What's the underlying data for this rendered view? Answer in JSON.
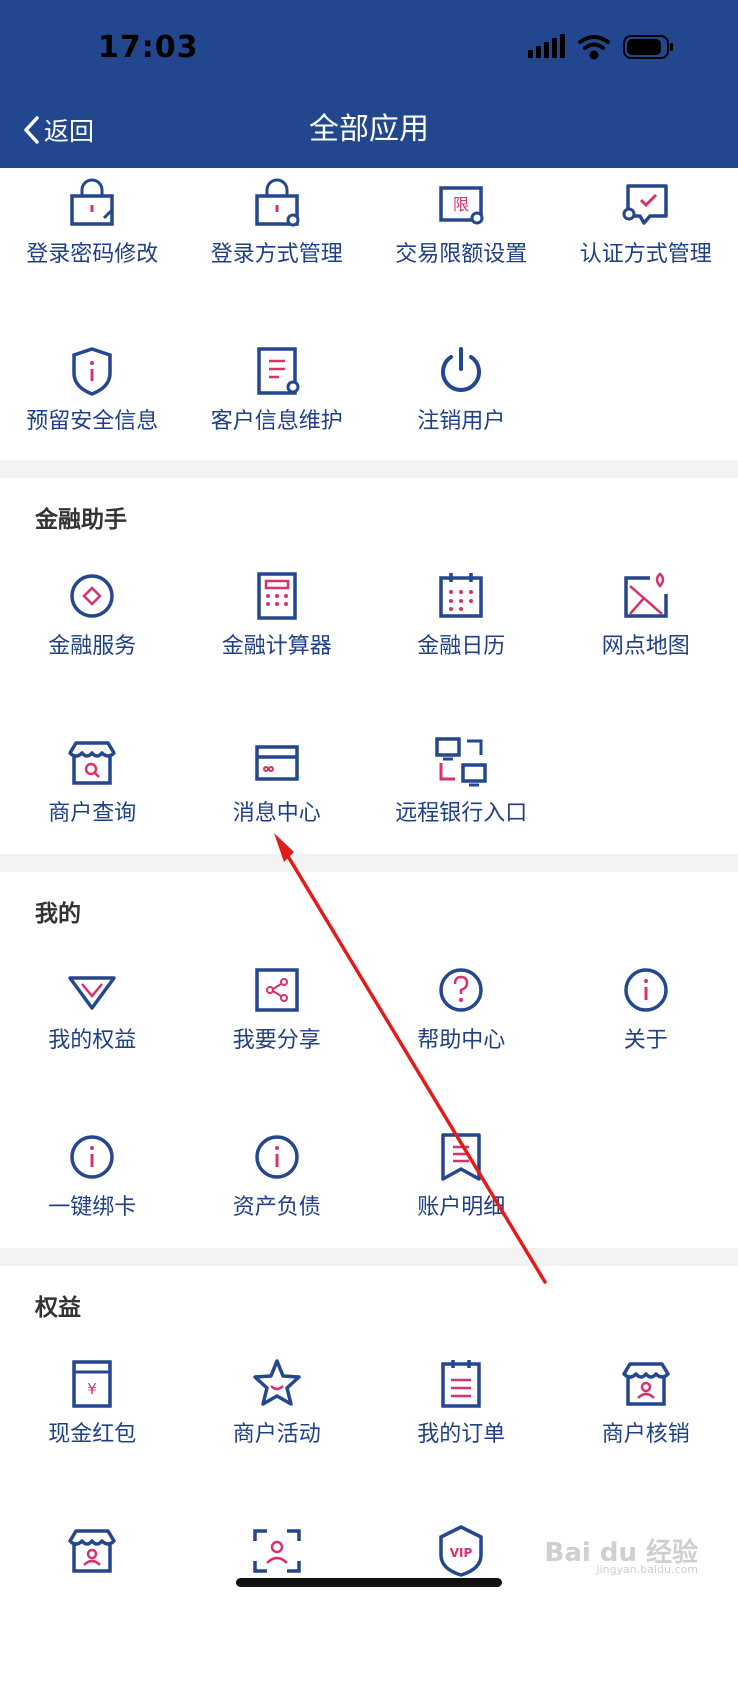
{
  "status_bar": {
    "time": "17:03"
  },
  "header": {
    "back_label": "返回",
    "title": "全部应用"
  },
  "section_security": {
    "items": [
      {
        "label": "登录密码修改",
        "icon": "lock-edit-icon"
      },
      {
        "label": "登录方式管理",
        "icon": "lock-gear-icon"
      },
      {
        "label": "交易限额设置",
        "icon": "limit-gear-icon"
      },
      {
        "label": "认证方式管理",
        "icon": "chat-check-icon"
      },
      {
        "label": "预留安全信息",
        "icon": "shield-info-icon"
      },
      {
        "label": "客户信息维护",
        "icon": "doc-gear-icon"
      },
      {
        "label": "注销用户",
        "icon": "power-icon"
      }
    ]
  },
  "section_finance": {
    "title": "金融助手",
    "items": [
      {
        "label": "金融服务",
        "icon": "diamond-circle-icon"
      },
      {
        "label": "金融计算器",
        "icon": "calculator-icon"
      },
      {
        "label": "金融日历",
        "icon": "calendar-icon"
      },
      {
        "label": "网点地图",
        "icon": "map-pin-icon"
      },
      {
        "label": "商户查询",
        "icon": "store-search-icon"
      },
      {
        "label": "消息中心",
        "icon": "card-icon"
      },
      {
        "label": "远程银行入口",
        "icon": "remote-monitors-icon"
      }
    ]
  },
  "section_mine": {
    "title": "我的",
    "items": [
      {
        "label": "我的权益",
        "icon": "diamond-icon"
      },
      {
        "label": "我要分享",
        "icon": "share-icon"
      },
      {
        "label": "帮助中心",
        "icon": "question-icon"
      },
      {
        "label": "关于",
        "icon": "info-icon"
      },
      {
        "label": "一键绑卡",
        "icon": "info-icon"
      },
      {
        "label": "资产负债",
        "icon": "info-icon"
      },
      {
        "label": "账户明细",
        "icon": "bookmark-list-icon"
      }
    ]
  },
  "section_rights": {
    "title": "权益",
    "items": [
      {
        "label": "现金红包",
        "icon": "red-packet-icon"
      },
      {
        "label": "商户活动",
        "icon": "star-icon"
      },
      {
        "label": "我的订单",
        "icon": "order-icon"
      },
      {
        "label": "商户核销",
        "icon": "store-user-icon"
      },
      {
        "label": "",
        "icon": "store-user-icon"
      },
      {
        "label": "",
        "icon": "scan-user-icon"
      },
      {
        "label": "",
        "icon": "vip-shield-icon"
      }
    ]
  },
  "watermark": {
    "main": "Bai du 经验",
    "sub": "jingyan.baidu.com"
  },
  "colors": {
    "header": "#22478f",
    "icon_blue": "#24478f",
    "accent_pink": "#d9316e",
    "annotation_arrow": "#e31b1b"
  }
}
